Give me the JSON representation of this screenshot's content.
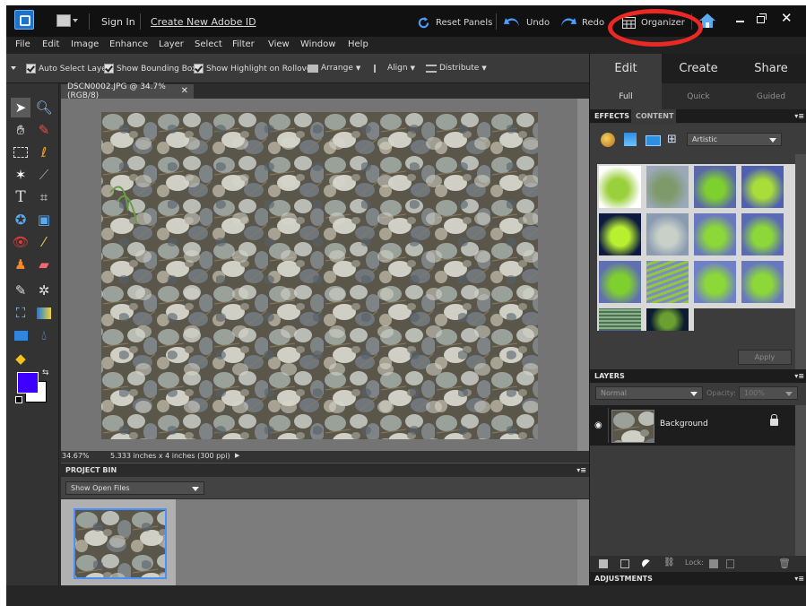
{
  "titlebar": {
    "sign_in": "Sign In",
    "create_id": "Create New Adobe ID",
    "reset_panels": "Reset Panels",
    "undo": "Undo",
    "redo": "Redo",
    "organizer": "Organizer"
  },
  "menu": [
    "File",
    "Edit",
    "Image",
    "Enhance",
    "Layer",
    "Select",
    "Filter",
    "View",
    "Window",
    "Help"
  ],
  "options": {
    "auto_select": "Auto Select Layer",
    "bounding_box": "Show Bounding Box",
    "highlight": "Show Highlight on Rollover",
    "arrange": "Arrange",
    "align": "Align",
    "distribute": "Distribute"
  },
  "document": {
    "tab_title": "DSCN0002.JPG @ 34.7% (RGB/8)",
    "zoom": "34.67%",
    "doc_size": "5.333 inches x 4 inches (300 ppi)"
  },
  "project_bin": {
    "title": "PROJECT BIN",
    "show": "Show Open Files"
  },
  "panel": {
    "modes": [
      "Edit",
      "Create",
      "Share"
    ],
    "submodes": [
      "Full",
      "Quick",
      "Guided"
    ],
    "effects_tab": "EFFECTS",
    "content_tab": "CONTENT",
    "category": "Artistic",
    "apply": "Apply",
    "layers_title": "LAYERS",
    "blend_mode": "Normal",
    "opacity_label": "Opacity:",
    "opacity_value": "100%",
    "layer_name": "Background",
    "lock_label": "Lock:",
    "adjustments": "ADJUSTMENTS"
  },
  "colors": {
    "foreground": "#3d00ff",
    "background": "#ffffff",
    "highlight": "#ea2824"
  }
}
